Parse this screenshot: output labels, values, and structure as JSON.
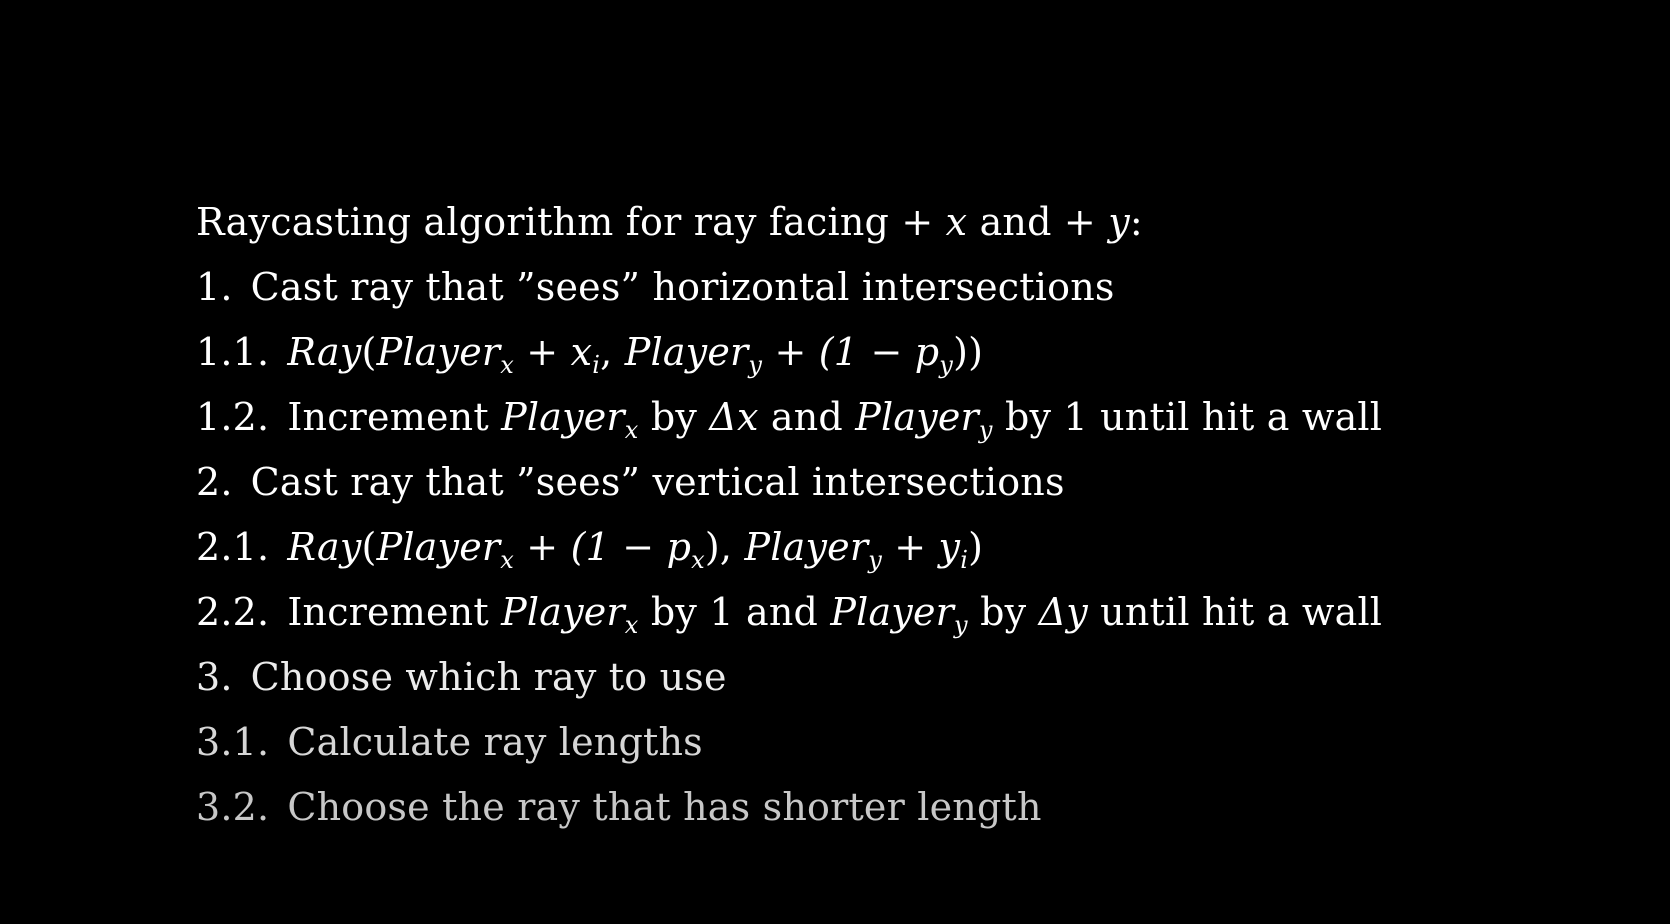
{
  "title": {
    "prefix": "Raycasting algorithm for ray facing",
    "plus_x": "+ x",
    "and": "and",
    "plus_y": "+ y",
    "colon": ":"
  },
  "steps": [
    {
      "num": "1.",
      "text": "Cast ray that ”sees” horizontal intersections"
    },
    {
      "num": "1.1.",
      "math": {
        "ray": "Ray",
        "open": "(",
        "player1": "Player",
        "sub1": "x",
        "mid1": " + x",
        "sub_i": "i",
        "comma": ", ",
        "player2": "Player",
        "sub2": "y",
        "tail": " + (1 − p",
        "sub3": "y",
        "close": "))"
      }
    },
    {
      "num": "1.2.",
      "inc": "Increment",
      "player_x": "Player",
      "sub_x": "x",
      "by1": "by",
      "delta_x": "Δx",
      "and": "and",
      "player_y": "Player",
      "sub_y": "y",
      "by2": "by",
      "amount": "1",
      "rest": "until hit a wall"
    },
    {
      "num": "2.",
      "text": "Cast ray that ”sees” vertical intersections"
    },
    {
      "num": "2.1.",
      "math": {
        "ray": "Ray",
        "open": "(",
        "player1": "Player",
        "sub1": "x",
        "mid1": " + (1 − p",
        "sub_px": "x",
        "mid2": "), ",
        "player2": "Player",
        "sub2": "y",
        "tail": " + y",
        "sub_i": "i",
        "close": ")"
      }
    },
    {
      "num": "2.2.",
      "inc": "Increment",
      "player_x": "Player",
      "sub_x": "x",
      "by1": "by",
      "amount": "1",
      "and": "and",
      "player_y": "Player",
      "sub_y": "y",
      "by2": "by",
      "delta_y": "Δy",
      "rest": "until hit a wall"
    },
    {
      "num": "3.",
      "text": "Choose which ray to use"
    },
    {
      "num": "3.1.",
      "text": "Calculate ray lengths"
    },
    {
      "num": "3.2.",
      "text": "Choose the ray that has shorter length"
    }
  ]
}
